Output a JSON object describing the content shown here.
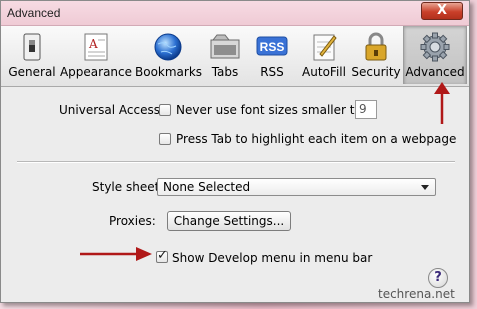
{
  "window": {
    "title": "Advanced",
    "close_label": "X"
  },
  "toolbar": {
    "items": [
      {
        "label": "General",
        "icon": "general-switch-icon"
      },
      {
        "label": "Appearance",
        "icon": "appearance-icon"
      },
      {
        "label": "Bookmarks",
        "icon": "globe-icon"
      },
      {
        "label": "Tabs",
        "icon": "tabs-icon"
      },
      {
        "label": "RSS",
        "icon": "rss-icon",
        "icon_text": "RSS"
      },
      {
        "label": "AutoFill",
        "icon": "pencil-paper-icon"
      },
      {
        "label": "Security",
        "icon": "lock-icon"
      },
      {
        "label": "Advanced",
        "icon": "gear-icon",
        "selected": true
      }
    ]
  },
  "advanced": {
    "universal_access_label": "Universal Access:",
    "min_font_label": "Never use font sizes smaller than",
    "min_font_value": "9",
    "min_font_checked": false,
    "press_tab_label": "Press Tab to highlight each item on a webpage",
    "press_tab_checked": false,
    "style_sheet_label": "Style sheet:",
    "style_sheet_value": "None Selected",
    "proxies_label": "Proxies:",
    "change_settings_label": "Change Settings...",
    "develop_menu_label": "Show Develop menu in menu bar",
    "develop_menu_checked": true,
    "help_label": "?"
  },
  "watermark": "techrena.net",
  "colors": {
    "annotation_arrow": "#b01818",
    "close_button": "#c9402a",
    "background": "#e8b9c6"
  }
}
